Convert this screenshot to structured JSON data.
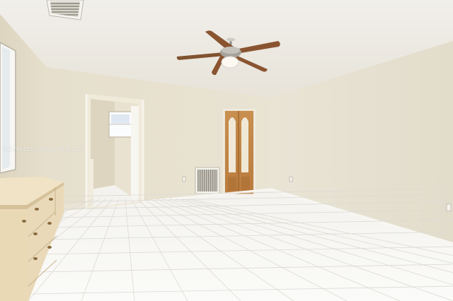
{
  "photo": {
    "watermark": "A11795123 © Miami MLS 2025"
  }
}
